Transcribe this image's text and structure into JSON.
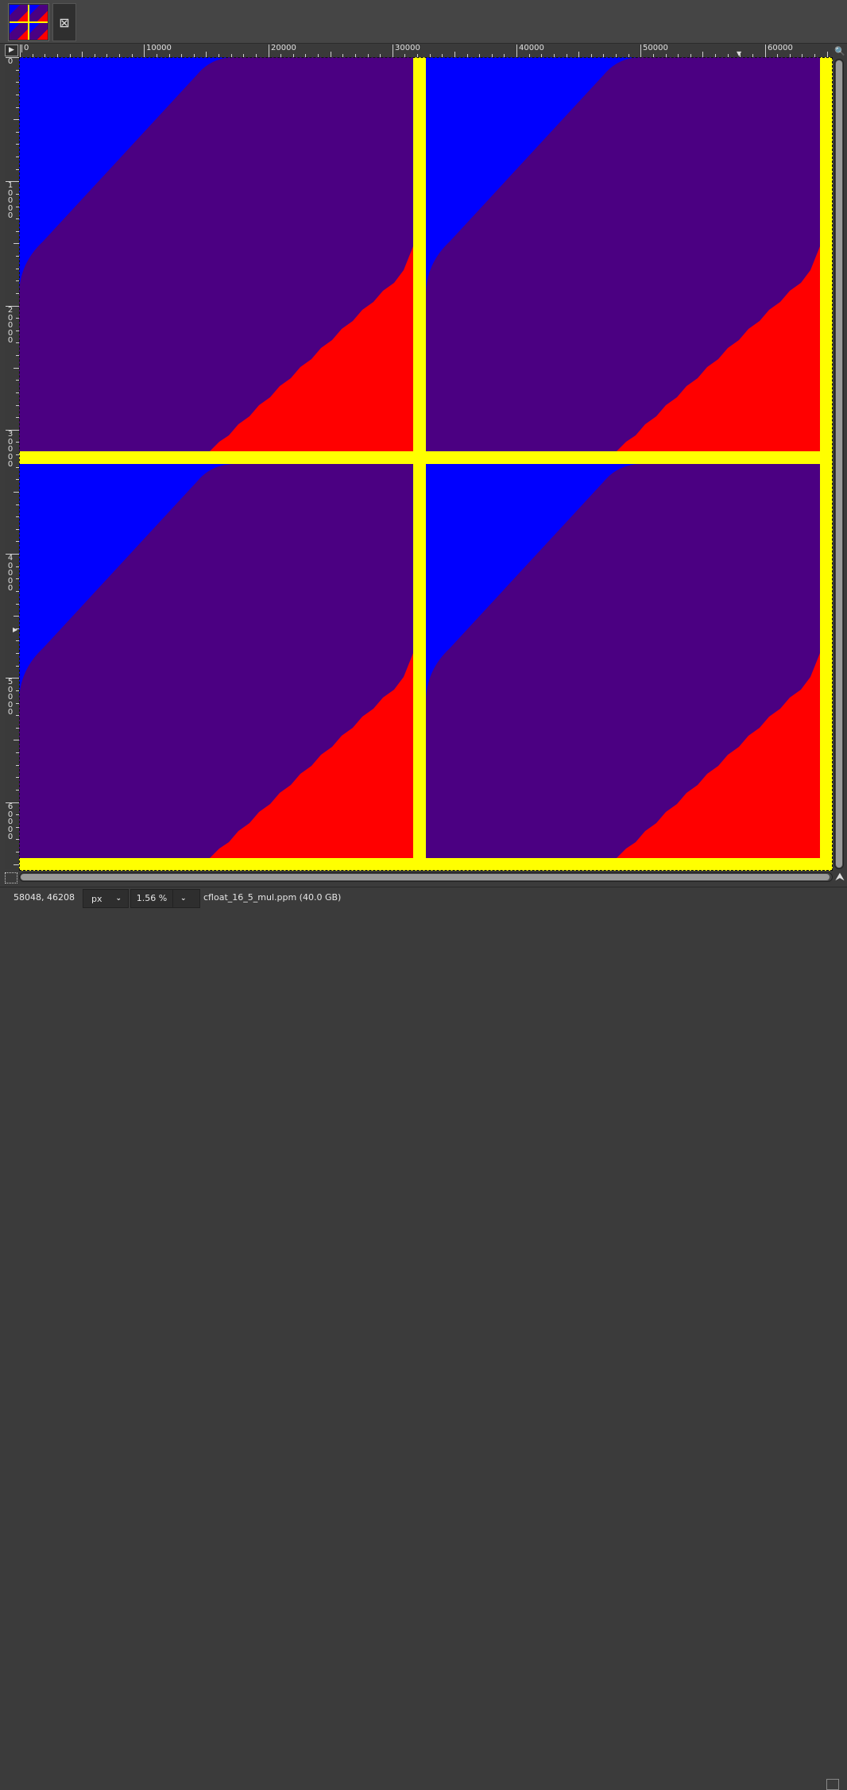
{
  "tab": {
    "close_glyph": "⊠",
    "thumbnail_colors": [
      "#0000ff",
      "#ff0000",
      "#4b0082",
      "#ffff00"
    ]
  },
  "rulers": {
    "horizontal_labels": [
      "0",
      "10000",
      "20000",
      "30000",
      "40000",
      "50000",
      "60000"
    ],
    "vertical_labels": [
      "0",
      "10000",
      "20000",
      "30000",
      "40000",
      "50000",
      "60000"
    ]
  },
  "canvas": {
    "colors": {
      "blue": "#0000ff",
      "purple": "#4b0082",
      "red": "#ff0000",
      "yellow": "#ffff00"
    }
  },
  "statusbar": {
    "pointer_coords": "58048, 46208",
    "unit": "px",
    "zoom": "1.56 %",
    "image_info": "cfloat_16_5_mul.ppm (40.0 GB)"
  },
  "icons": {
    "zoom": "🔍",
    "navigate": "⮝",
    "menu": "▶"
  }
}
